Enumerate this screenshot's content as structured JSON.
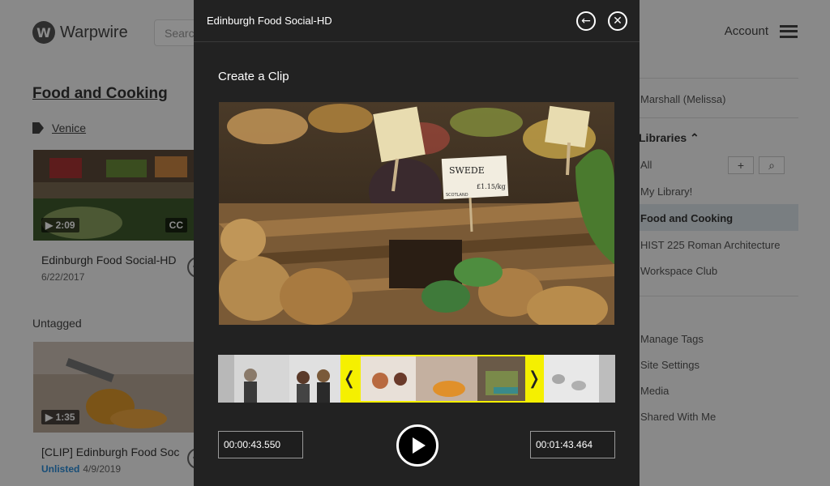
{
  "header": {
    "logo_letter": "W",
    "logo_text": "Warpwire",
    "search_placeholder": "Search",
    "account_label": "Account"
  },
  "library": {
    "title": "Food and Cooking",
    "tag_label": "Venice",
    "untagged_label": "Untagged",
    "cards": [
      {
        "duration": "2:09",
        "cc": "CC",
        "title": "Edinburgh Food Social-HD",
        "date": "6/22/2017",
        "unlisted": ""
      },
      {
        "duration": "1:35",
        "cc": "",
        "title": "[CLIP] Edinburgh Food Social-HD",
        "date": "4/9/2019",
        "unlisted": "Unlisted"
      }
    ]
  },
  "sidebar": {
    "user": "Marshall (Melissa)",
    "libraries_heading": "Libraries",
    "all_label": "All",
    "items": [
      "My Library!",
      "Food and Cooking",
      "HIST 225 Roman Architecture",
      "Workspace Club"
    ],
    "bottom_items": [
      "Manage Tags",
      "Site Settings",
      "Media",
      "Shared With Me"
    ]
  },
  "modal": {
    "title": "Edinburgh Food Social-HD",
    "back_icon": "back-arrow-icon",
    "close_icon": "close-icon",
    "heading": "Create a Clip",
    "start_time": "00:00:43.550",
    "end_time": "00:01:43.464",
    "handle_left": "❬",
    "handle_right": "❭"
  },
  "video_sign": {
    "line1": "SWEDE",
    "line2": "£1.15/kg",
    "line3": "SCOTLAND"
  },
  "colors": {
    "accent_yellow": "#f5f000",
    "modal_bg": "#222222",
    "unlisted_blue": "#2b8cd9"
  }
}
